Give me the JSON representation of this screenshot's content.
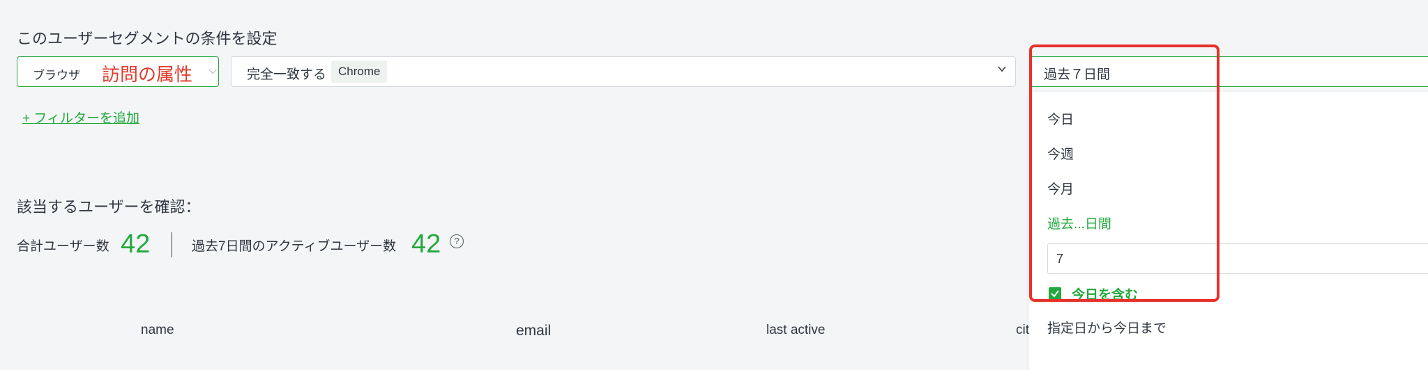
{
  "segment": {
    "section_title": "このユーザーセグメントの条件を設定",
    "attribute_select": {
      "value": "ブラウザ",
      "annotation": "訪問の属性"
    },
    "condition": {
      "operator": "完全一致する",
      "value_chip": "Chrome"
    },
    "period": {
      "value": "過去７日間"
    },
    "add_filter": "+ フィルターを追加"
  },
  "users": {
    "section_title": "該当するユーザーを確認：",
    "total_label": "合計ユーザー数",
    "total_value": "42",
    "active_label": "過去7日間のアクティブユーザー数",
    "active_value": "42",
    "help_icon_glyph": "?"
  },
  "table": {
    "columns": [
      "name",
      "email",
      "last active",
      "cit"
    ]
  },
  "period_dropdown": {
    "options": [
      "今日",
      "今週",
      "今月",
      "過去...日間"
    ],
    "days_value": "7",
    "include_today_label": "今日を含む",
    "include_today_checked": true,
    "custom_range_label": "指定日から今日まで"
  },
  "colors": {
    "accent_green": "#22a83c",
    "highlight_red": "#e6322a",
    "text": "#2f3640"
  },
  "icons": {
    "attribute_chevron": "chevron-down-icon",
    "condition_chevron": "chevron-down-icon",
    "help": "question-circle-icon",
    "checkbox": "check-icon"
  }
}
